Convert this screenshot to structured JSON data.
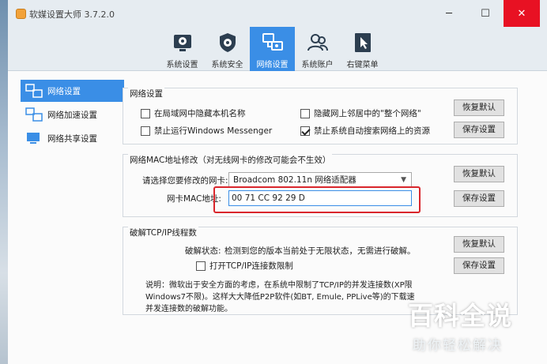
{
  "window": {
    "title": "软媒设置大师 3.7.2.0",
    "controls": {
      "minimize": "─",
      "maximize": "☐",
      "close": "✕"
    }
  },
  "toolbar": {
    "tabs": [
      {
        "label": "系统设置",
        "icon": "system-gear-icon",
        "active": false
      },
      {
        "label": "系统安全",
        "icon": "shield-gear-icon",
        "active": false
      },
      {
        "label": "网络设置",
        "icon": "network-icon",
        "active": true
      },
      {
        "label": "系统账户",
        "icon": "users-icon",
        "active": false
      },
      {
        "label": "右键菜单",
        "icon": "cursor-icon",
        "active": false
      }
    ],
    "accent": "#3a8ee6"
  },
  "sidebar": {
    "items": [
      {
        "label": "网络设置",
        "icon": "network-settings-icon",
        "active": true
      },
      {
        "label": "网络加速设置",
        "icon": "network-speed-icon",
        "active": false
      },
      {
        "label": "网络共享设置",
        "icon": "network-share-icon",
        "active": false
      }
    ]
  },
  "network_settings": {
    "title": "网络设置",
    "options": [
      {
        "label": "在局域网中隐藏本机名称",
        "checked": false
      },
      {
        "label": "隐藏网上邻居中的\"整个网络\"",
        "checked": false
      },
      {
        "label": "禁止运行Windows Messenger",
        "checked": false
      },
      {
        "label": "禁止系统自动搜索网络上的资源",
        "checked": true
      }
    ],
    "restore_label": "恢复默认",
    "save_label": "保存设置"
  },
  "mac": {
    "title": "网络MAC地址修改（对无线网卡的修改可能会不生效）",
    "select_label": "请选择您要修改的网卡:",
    "select_value": "Broadcom 802.11n 网络适配器",
    "mac_label": "网卡MAC地址:",
    "mac_value": "00 71 CC 92 29 D",
    "restore_label": "恢复默认",
    "save_label": "保存设置",
    "highlight_color": "#d9262c"
  },
  "tcp": {
    "title": "破解TCP/IP线程数",
    "status_label": "破解状态:",
    "status_text": "检测到您的版本当前处于无限状态，无需进行破解。",
    "checkbox_label": "打开TCP/IP连接数限制",
    "checkbox_checked": false,
    "note_line1": "说明：微软出于安全方面的考虑，在系统中限制了TCP/IP的并发连接数(XP限",
    "note_line2": "Windows7不限)。这样大大降低P2P软件(如BT, Emule, PPLive等)的下载速度",
    "note_line3": "并发连接数的破解功能。",
    "restore_label": "恢复默认",
    "save_label": "保存设置"
  },
  "watermark": {
    "big": "百科全说",
    "small": "助你轻松解决"
  }
}
